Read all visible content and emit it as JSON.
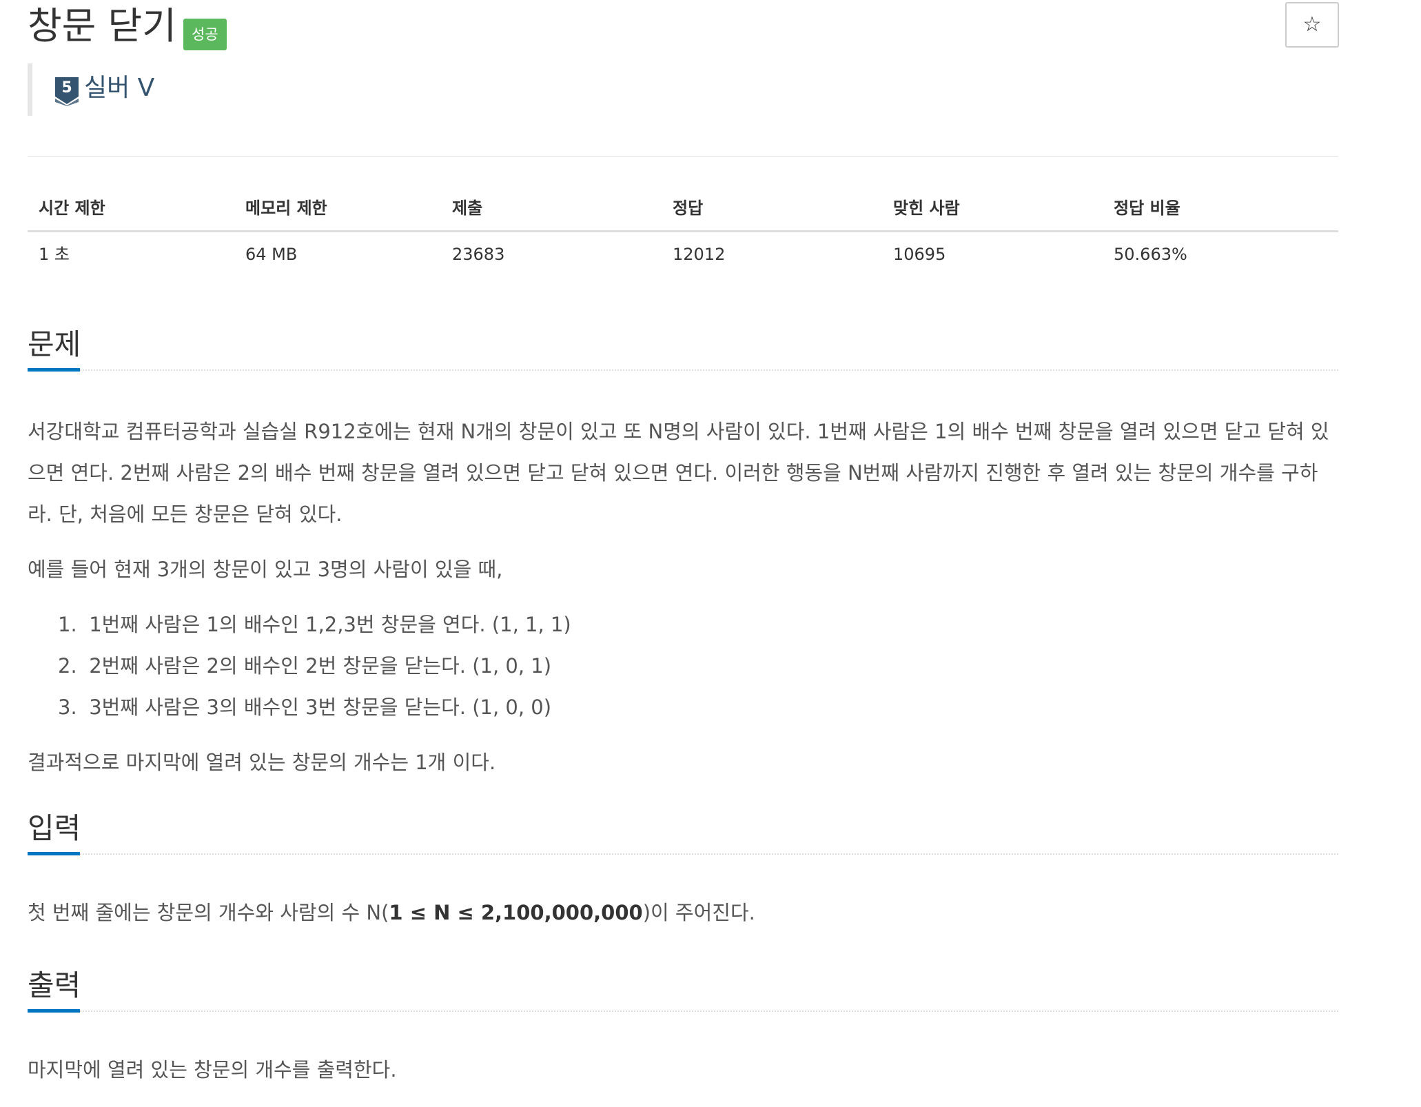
{
  "problem": {
    "title": "창문 닫기",
    "status_badge": "성공",
    "star_symbol": "☆",
    "tier": {
      "icon_number": "5",
      "label": "실버 V",
      "color": "#35546f"
    }
  },
  "stats": {
    "headers": [
      "시간 제한",
      "메모리 제한",
      "제출",
      "정답",
      "맞힌 사람",
      "정답 비율"
    ],
    "values": [
      "1 초",
      "64 MB",
      "23683",
      "12012",
      "10695",
      "50.663%"
    ]
  },
  "sections": {
    "description": {
      "title": "문제",
      "paragraph1": "서강대학교 컴퓨터공학과 실습실 R912호에는 현재 N개의 창문이 있고 또 N명의 사람이 있다. 1번째 사람은 1의 배수 번째 창문을 열려 있으면 닫고 닫혀 있으면 연다.  2번째 사람은 2의 배수 번째 창문을 열려 있으면 닫고 닫혀 있으면 연다. 이러한 행동을 N번째 사람까지 진행한 후 열려 있는 창문의 개수를 구하라. 단, 처음에 모든 창문은 닫혀 있다.",
      "paragraph2": "예를 들어 현재 3개의 창문이 있고 3명의 사람이 있을 때,",
      "list": [
        {
          "num": "1.",
          "text": "1번째 사람은 1의 배수인 1,2,3번 창문을 연다. (1, 1, 1)"
        },
        {
          "num": "2.",
          "text": "2번째 사람은 2의 배수인 2번 창문을 닫는다. (1, 0, 1)"
        },
        {
          "num": "3.",
          "text": "3번째 사람은 3의 배수인 3번 창문을 닫는다. (1, 0, 0)"
        }
      ],
      "paragraph3": "결과적으로 마지막에 열려 있는 창문의 개수는 1개 이다."
    },
    "input": {
      "title": "입력",
      "text_before": "첫 번째 줄에는 창문의 개수와 사람의 수 N(",
      "bold": "1 ≤ N ≤ 2,100,000,000",
      "text_after": ")이 주어진다."
    },
    "output": {
      "title": "출력",
      "text": "마지막에 열려 있는 창문의 개수를 출력한다."
    }
  },
  "colors": {
    "accent": "#0076c0",
    "success_badge": "#5cb85c",
    "tier_silver": "#35546f"
  }
}
